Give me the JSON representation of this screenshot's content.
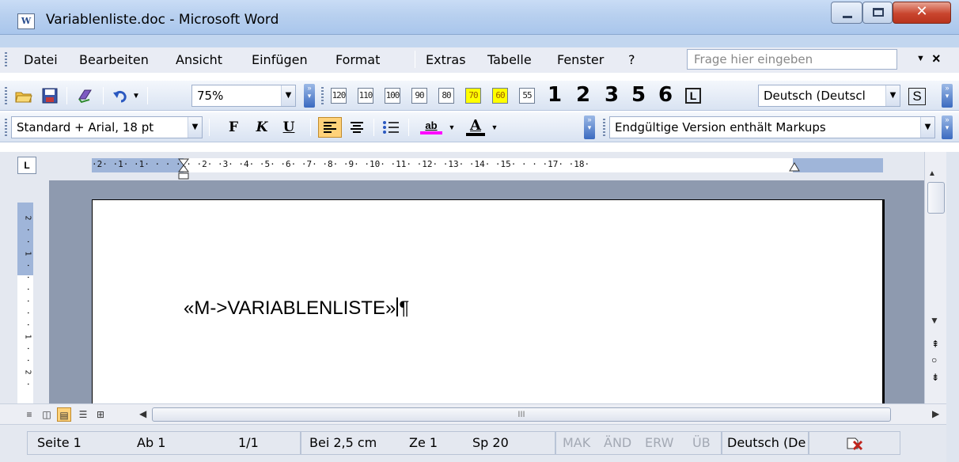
{
  "window": {
    "title": "Variablenliste.doc - Microsoft Word",
    "minimize_glyph": "—",
    "maximize_glyph": "□",
    "close_glyph": "✕"
  },
  "menu": {
    "items": [
      {
        "label": "Datei"
      },
      {
        "label": "Bearbeiten"
      },
      {
        "label": "Ansicht"
      },
      {
        "label": "Einfügen"
      },
      {
        "label": "Format"
      },
      {
        "label": "Extras"
      },
      {
        "label": "Tabelle"
      },
      {
        "label": "Fenster"
      },
      {
        "label": "?"
      }
    ],
    "help_placeholder": "Frage hier eingeben",
    "close_glyph": "×"
  },
  "toolbar_standard": {
    "zoom_value": "75%",
    "number_icons": [
      "120",
      "110",
      "100",
      "90",
      "80",
      "70",
      "60",
      "55"
    ],
    "heading_numbers": [
      "1",
      "2",
      "3",
      "5",
      "6"
    ],
    "l_label": "L",
    "language_value": "Deutsch (Deutscl",
    "s_label": "S"
  },
  "toolbar_format": {
    "style_value": "Standard + Arial, 18 pt",
    "bold_label": "F",
    "italic_label": "K",
    "underline_label": "U",
    "highlight_label": "ab",
    "font_color_label": "A",
    "markup_view_value": "Endgültige Version enthält Markups"
  },
  "ruler": {
    "corner_label": "L",
    "horizontal_text": "·2· ·1· ·1· ·  · ·1· ·2· ·3· ·4· ·5· ·6· ·7· ·8· ·9· ·10· ·11· ·12· ·13· ·14· ·15· · · ·17· ·18·",
    "vertical_text": "2\n·\n·\n1\n·\n·\n·\n·\n·\n·\n1\n·\n·\n2\n·"
  },
  "document": {
    "text": "«M->VARIABLENLISTE»",
    "pilcrow": "¶"
  },
  "hscroll": {
    "thumb_grip": "III"
  },
  "status": {
    "page": "Seite 1",
    "section": "Ab 1",
    "pages": "1/1",
    "at": "Bei 2,5 cm",
    "line": "Ze 1",
    "column": "Sp 20",
    "mak": "MAK",
    "and": "ÄND",
    "erw": "ERW",
    "ub": "ÜB",
    "language": "Deutsch (De"
  },
  "colors": {
    "title_bar": "#b8d0ef",
    "toolbar": "#d9e3f2",
    "doc_background": "#8e9aaf",
    "close_button": "#c9452e",
    "active_toggle": "#ffd27a"
  }
}
